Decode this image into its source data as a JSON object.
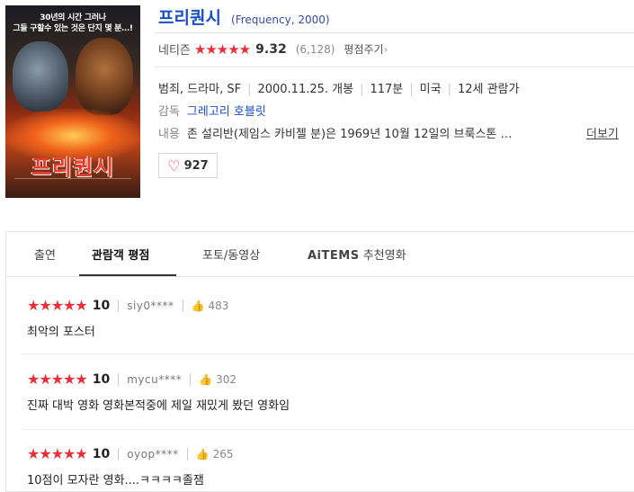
{
  "poster": {
    "tagline": "30년의 시간 그러나\n그들 구할수 있는 것은 단지 몇 분…!",
    "title": "프리퀀시"
  },
  "movie": {
    "title": "프리퀀시",
    "original": "(Frequency, 2000)"
  },
  "rating": {
    "label": "네티즌",
    "stars": "★★★★★",
    "score": "9.32",
    "count": "(6,128)",
    "rate_link": "평점주기",
    "star_color": "#e8303a"
  },
  "info": {
    "genre": "범죄, 드라마, SF",
    "release": "2000.11.25. 개봉",
    "runtime": "117분",
    "country": "미국",
    "age": "12세 관람가",
    "director_label": "감독",
    "director": "그레고리 호블릿",
    "plot_label": "내용",
    "plot": "존 설리반(제임스 카비젤 분)은 1969년 10월 12일의 브룩스톤 …",
    "more": "더보기"
  },
  "like": {
    "icon": "heart-icon",
    "count": "927"
  },
  "tabs": {
    "cast": "출연",
    "reviews": "관람객 평점",
    "photos": "포토/동영상",
    "aitems": "AiTEMS",
    "recommend": "추천영화"
  },
  "reviews": [
    {
      "stars": "★★★★★",
      "score": "10",
      "user": "siy0****",
      "likes": "483",
      "text": "최악의 포스터"
    },
    {
      "stars": "★★★★★",
      "score": "10",
      "user": "mycu****",
      "likes": "302",
      "text": "진짜 대박 영화 영화본적중에 제일 재밌게 봤던 영화임"
    },
    {
      "stars": "★★★★★",
      "score": "10",
      "user": "oyop****",
      "likes": "265",
      "text": "10점이 모자란 영화....ㅋㅋㅋㅋ졸잼"
    }
  ]
}
